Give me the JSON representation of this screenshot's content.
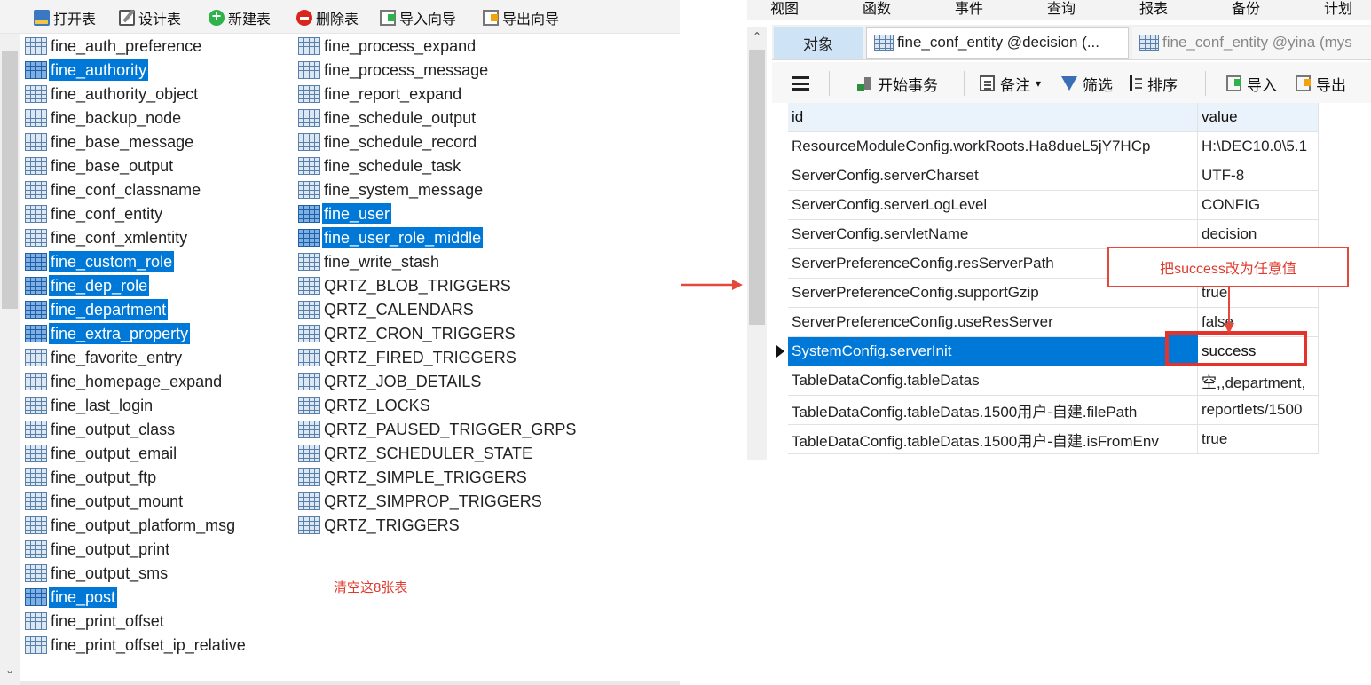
{
  "left_toolbar": {
    "open_label": "打开表",
    "design_label": "设计表",
    "new_label": "新建表",
    "delete_label": "删除表",
    "import_label": "导入向导",
    "export_label": "导出向导"
  },
  "tables_col1": [
    {
      "name": "fine_auth_preference",
      "selected": false
    },
    {
      "name": "fine_authority",
      "selected": true
    },
    {
      "name": "fine_authority_object",
      "selected": false
    },
    {
      "name": "fine_backup_node",
      "selected": false
    },
    {
      "name": "fine_base_message",
      "selected": false
    },
    {
      "name": "fine_base_output",
      "selected": false
    },
    {
      "name": "fine_conf_classname",
      "selected": false
    },
    {
      "name": "fine_conf_entity",
      "selected": false
    },
    {
      "name": "fine_conf_xmlentity",
      "selected": false
    },
    {
      "name": "fine_custom_role",
      "selected": true
    },
    {
      "name": "fine_dep_role",
      "selected": true
    },
    {
      "name": "fine_department",
      "selected": true
    },
    {
      "name": "fine_extra_property",
      "selected": true
    },
    {
      "name": "fine_favorite_entry",
      "selected": false
    },
    {
      "name": "fine_homepage_expand",
      "selected": false
    },
    {
      "name": "fine_last_login",
      "selected": false
    },
    {
      "name": "fine_output_class",
      "selected": false
    },
    {
      "name": "fine_output_email",
      "selected": false
    },
    {
      "name": "fine_output_ftp",
      "selected": false
    },
    {
      "name": "fine_output_mount",
      "selected": false
    },
    {
      "name": "fine_output_platform_msg",
      "selected": false
    },
    {
      "name": "fine_output_print",
      "selected": false
    },
    {
      "name": "fine_output_sms",
      "selected": false
    },
    {
      "name": "fine_post",
      "selected": true
    },
    {
      "name": "fine_print_offset",
      "selected": false
    },
    {
      "name": "fine_print_offset_ip_relative",
      "selected": false
    }
  ],
  "tables_col2": [
    {
      "name": "fine_process_expand",
      "selected": false
    },
    {
      "name": "fine_process_message",
      "selected": false
    },
    {
      "name": "fine_report_expand",
      "selected": false
    },
    {
      "name": "fine_schedule_output",
      "selected": false
    },
    {
      "name": "fine_schedule_record",
      "selected": false
    },
    {
      "name": "fine_schedule_task",
      "selected": false
    },
    {
      "name": "fine_system_message",
      "selected": false
    },
    {
      "name": "fine_user",
      "selected": true
    },
    {
      "name": "fine_user_role_middle",
      "selected": true
    },
    {
      "name": "fine_write_stash",
      "selected": false
    },
    {
      "name": "QRTZ_BLOB_TRIGGERS",
      "selected": false
    },
    {
      "name": "QRTZ_CALENDARS",
      "selected": false
    },
    {
      "name": "QRTZ_CRON_TRIGGERS",
      "selected": false
    },
    {
      "name": "QRTZ_FIRED_TRIGGERS",
      "selected": false
    },
    {
      "name": "QRTZ_JOB_DETAILS",
      "selected": false
    },
    {
      "name": "QRTZ_LOCKS",
      "selected": false
    },
    {
      "name": "QRTZ_PAUSED_TRIGGER_GRPS",
      "selected": false
    },
    {
      "name": "QRTZ_SCHEDULER_STATE",
      "selected": false
    },
    {
      "name": "QRTZ_SIMPLE_TRIGGERS",
      "selected": false
    },
    {
      "name": "QRTZ_SIMPROP_TRIGGERS",
      "selected": false
    },
    {
      "name": "QRTZ_TRIGGERS",
      "selected": false
    }
  ],
  "left_note": "清空这8张表",
  "right_menu": [
    "视图",
    "函数",
    "事件",
    "查询",
    "报表",
    "备份",
    "计划"
  ],
  "right_tabs": {
    "objects": "对象",
    "tab1": "fine_conf_entity @decision (...",
    "tab2": "fine_conf_entity @yina (mys"
  },
  "right_toolbar": {
    "begin_transaction": "开始事务",
    "memo": "备注",
    "filter": "筛选",
    "sort": "排序",
    "import": "导入",
    "export": "导出"
  },
  "grid": {
    "headers": {
      "id": "id",
      "value": "value"
    },
    "rows": [
      {
        "id": "ResourceModuleConfig.workRoots.Ha8dueL5jY7HCp",
        "value": "H:\\DEC10.0\\5.1",
        "selected": false
      },
      {
        "id": "ServerConfig.serverCharset",
        "value": "UTF-8",
        "selected": false
      },
      {
        "id": "ServerConfig.serverLogLevel",
        "value": "CONFIG",
        "selected": false
      },
      {
        "id": "ServerConfig.servletName",
        "value": "decision",
        "selected": false
      },
      {
        "id": "ServerPreferenceConfig.resServerPath",
        "value": "",
        "selected": false
      },
      {
        "id": "ServerPreferenceConfig.supportGzip",
        "value": "true",
        "selected": false
      },
      {
        "id": "ServerPreferenceConfig.useResServer",
        "value": "false",
        "selected": false
      },
      {
        "id": "SystemConfig.serverInit",
        "value": "success",
        "selected": true
      },
      {
        "id": "TableDataConfig.tableDatas",
        "value": "空,,department,",
        "selected": false
      },
      {
        "id": "TableDataConfig.tableDatas.1500用户-自建.filePath",
        "value": "reportlets/1500",
        "selected": false
      },
      {
        "id": "TableDataConfig.tableDatas.1500用户-自建.isFromEnv",
        "value": "true",
        "selected": false
      }
    ]
  },
  "callout_text": "把success改为任意值",
  "colors": {
    "selection": "#0078d7",
    "annotation_red": "#e5322b"
  }
}
